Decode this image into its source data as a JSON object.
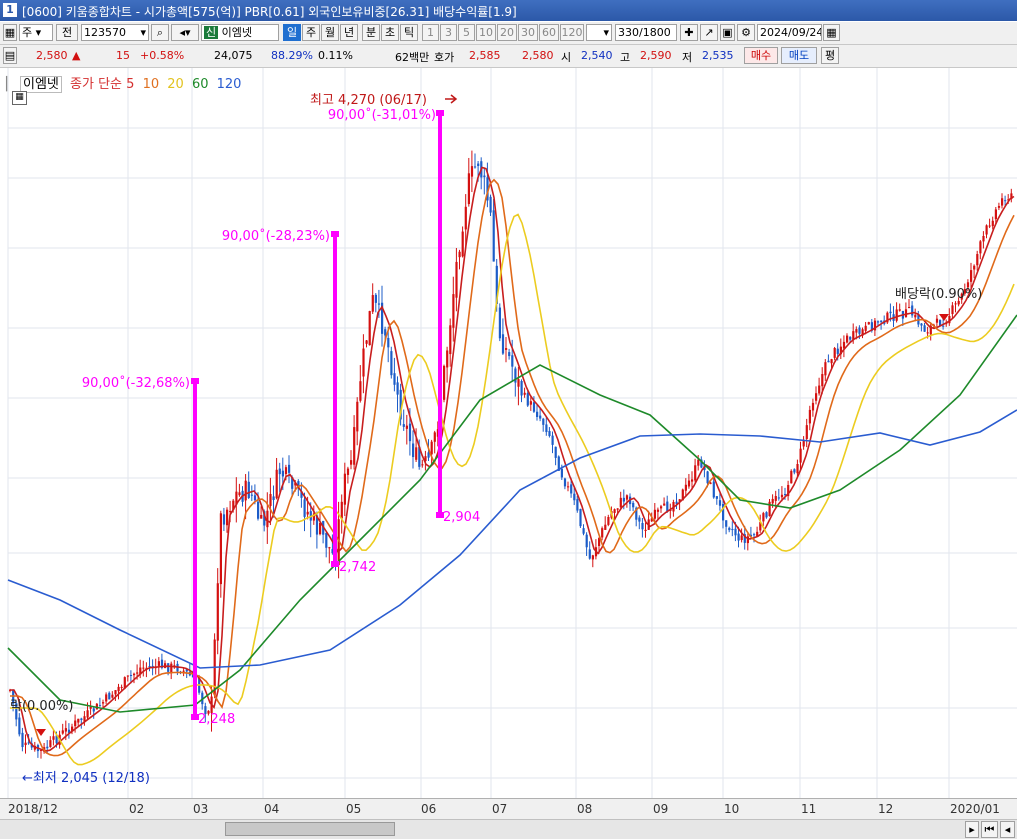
{
  "title": {
    "number": "1",
    "text": "[0600] 키움종합차트 - 시가총액[575(억)] PBR[0.61] 외국인보유비중[26.31] 배당수익률[1.9]"
  },
  "toolbar": {
    "type_label": "주",
    "prev_label": "전",
    "code": "123570",
    "stock_badge": "신",
    "stock_name": "이엠넷",
    "periods": [
      "일",
      "주",
      "월",
      "년",
      "분",
      "초",
      "틱"
    ],
    "selected_period": "일",
    "intervals": [
      "1",
      "3",
      "5",
      "10",
      "20",
      "30",
      "60",
      "120"
    ],
    "count": "330",
    "count_total": "/1800",
    "date": "2024/09/24"
  },
  "quote": {
    "price": "2,580",
    "change_arrow": "▲",
    "change": "15",
    "change_pct": "+0.58%",
    "volume": "24,075",
    "vol_ratio": "88.29%",
    "turnover": "0.11%",
    "amount": "62백만",
    "bid_label": "호가",
    "ask": "2,585",
    "bid": "2,580",
    "open_label": "시",
    "open": "2,540",
    "high_label": "고",
    "high": "2,590",
    "low_label": "저",
    "low": "2,535",
    "buy_label": "매수",
    "sell_label": "매도",
    "avg_label": "평"
  },
  "legend": {
    "name": "이엠넷",
    "ma_label": "종가 단순 5",
    "p10": "10",
    "p20": "20",
    "p60": "60",
    "p120": "120"
  },
  "chart_data": {
    "type": "line",
    "annotations": {
      "high": "최고 4,270 (06/17)",
      "low": "←최저 2,045 (12/18)",
      "drop1_pct": "90,00˚(-32,68%)",
      "drop1_low": "2,248",
      "drop2_pct": "90,00˚(-28,23%)",
      "drop2_low": "2,742",
      "drop3_pct": "90,00˚(-31,01%)",
      "drop3_low": "2,904",
      "div1": "락(0.00%)",
      "div2": "배당락(0.90%)"
    },
    "x_labels": [
      "2018/12",
      "02",
      "03",
      "04",
      "05",
      "06",
      "07",
      "08",
      "09",
      "10",
      "11",
      "12",
      "2020/01"
    ],
    "colors": {
      "candle_up": "#d41010",
      "candle_down": "#1c5cc8",
      "ma5": "#c81e1e",
      "ma10": "#e06a1a",
      "ma20": "#eccc20",
      "ma60": "#1e8a2a",
      "ma120": "#2a5cd0",
      "drop_line": "#ff00ff"
    }
  }
}
